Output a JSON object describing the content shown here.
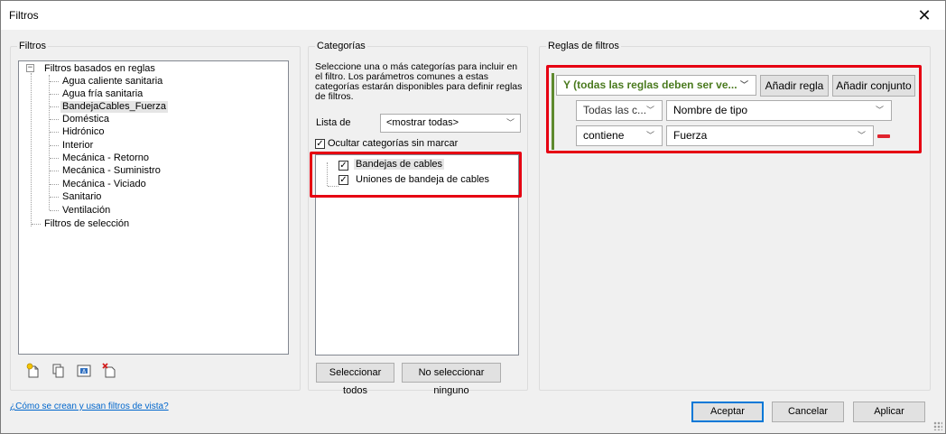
{
  "window": {
    "title": "Filtros"
  },
  "filters_panel": {
    "title": "Filtros",
    "rule_based_root": "Filtros basados en reglas",
    "rule_filters": [
      "Agua caliente sanitaria",
      "Agua fría sanitaria",
      "BandejaCables_Fuerza",
      "Doméstica",
      "Hidrónico",
      "Interior",
      "Mecánica - Retorno",
      "Mecánica - Suministro",
      "Mecánica - Viciado",
      "Sanitario",
      "Ventilación"
    ],
    "selected_filter": "BandejaCables_Fuerza",
    "selection_root": "Filtros de selección",
    "expander_symbol": "−"
  },
  "categories_panel": {
    "title": "Categorías",
    "description": "Seleccione una o más categorías para incluir en el filtro. Los parámetros comunes a estas categorías estarán disponibles para definir reglas de filtros.",
    "list_label": "Lista de",
    "list_value": "<mostrar todas>",
    "hide_unchecked_label": "Ocultar categorías sin marcar",
    "items": [
      {
        "label": "Bandejas de cables",
        "checked": true
      },
      {
        "label": "Uniones de bandeja de cables",
        "checked": true
      }
    ],
    "select_all": "Seleccionar todos",
    "select_none": "No seleccionar ninguno"
  },
  "rules_panel": {
    "title": "Reglas de filtros",
    "logic_value": "Y (todas las reglas deben ser ve...",
    "add_rule": "Añadir regla",
    "add_set": "Añadir conjunto",
    "rule": {
      "category_value": "Todas las c...",
      "parameter_value": "Nombre de tipo",
      "operator_value": "contiene",
      "value": "Fuerza"
    }
  },
  "footer": {
    "help_link": "¿Cómo se crean y usan filtros de vista?",
    "ok": "Aceptar",
    "cancel": "Cancelar",
    "apply": "Aplicar"
  },
  "icons": {
    "close": "close-icon",
    "new_filter": "new-filter-icon",
    "duplicate": "duplicate-icon",
    "rename": "rename-icon",
    "delete": "delete-filter-icon",
    "dropdown": "chevron-down-icon",
    "remove_rule": "remove-rule-icon"
  },
  "colors": {
    "highlight_frame": "#e60012",
    "logic_text": "#4a7a1e",
    "remove_rule": "#e0242e",
    "link": "#0066cc"
  }
}
